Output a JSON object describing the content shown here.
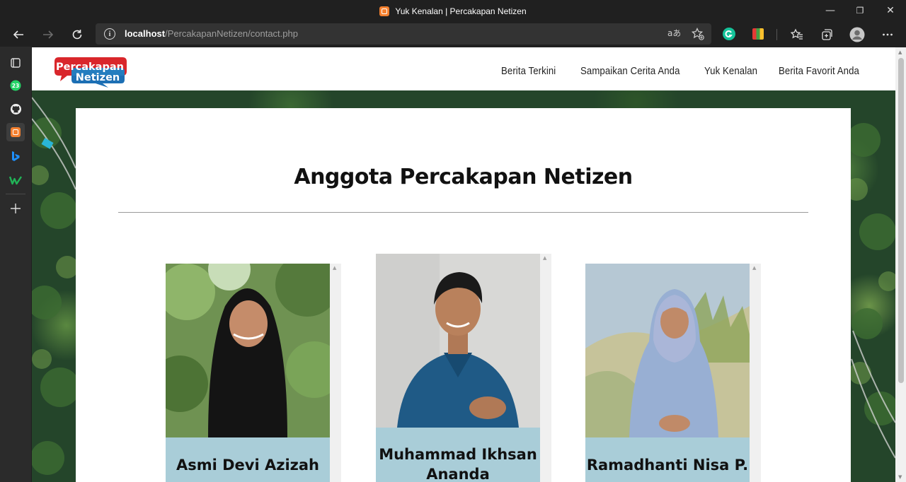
{
  "window": {
    "title": "Yuk Kenalan | Percakapan Netizen",
    "controls": {
      "minimize": "—",
      "restore": "❐",
      "close": "✕"
    }
  },
  "toolbar": {
    "url_host": "localhost",
    "url_path": "/PercakapanNetizen/contact.php"
  },
  "sidebar": {
    "icons": [
      "tabs-icon",
      "whatsapp-icon",
      "github-icon",
      "xampp-icon",
      "bing-icon",
      "webflow-icon",
      "add-icon"
    ],
    "whatsapp_badge": "23"
  },
  "site": {
    "logo": {
      "line1": "Percakapan",
      "line2": "Netizen"
    },
    "nav": [
      {
        "label": "Berita Terkini"
      },
      {
        "label": "Sampaikan Cerita Anda"
      },
      {
        "label": "Yuk Kenalan"
      },
      {
        "label": "Berita Favorit Anda"
      }
    ]
  },
  "page": {
    "heading": "Anggota Percakapan Netizen",
    "members": [
      {
        "name": "Asmi Devi Azizah",
        "scarf_color": "#141414",
        "bg_color": "#6f9252",
        "top_color": "#141414"
      },
      {
        "name": "Muhammad Ikhsan Ananda",
        "scarf_color": "#1c1c1c",
        "bg_color": "#d8d8d6",
        "top_color": "#1f5a86"
      },
      {
        "name": "Ramadhanti Nisa P.",
        "scarf_color": "#aab6d8",
        "bg_color": "#b9c6a4",
        "top_color": "#98afd3"
      }
    ]
  },
  "colors": {
    "name_banner": "#a9cdd8",
    "logo_red": "#d9262b",
    "logo_blue": "#1c6fb4"
  }
}
